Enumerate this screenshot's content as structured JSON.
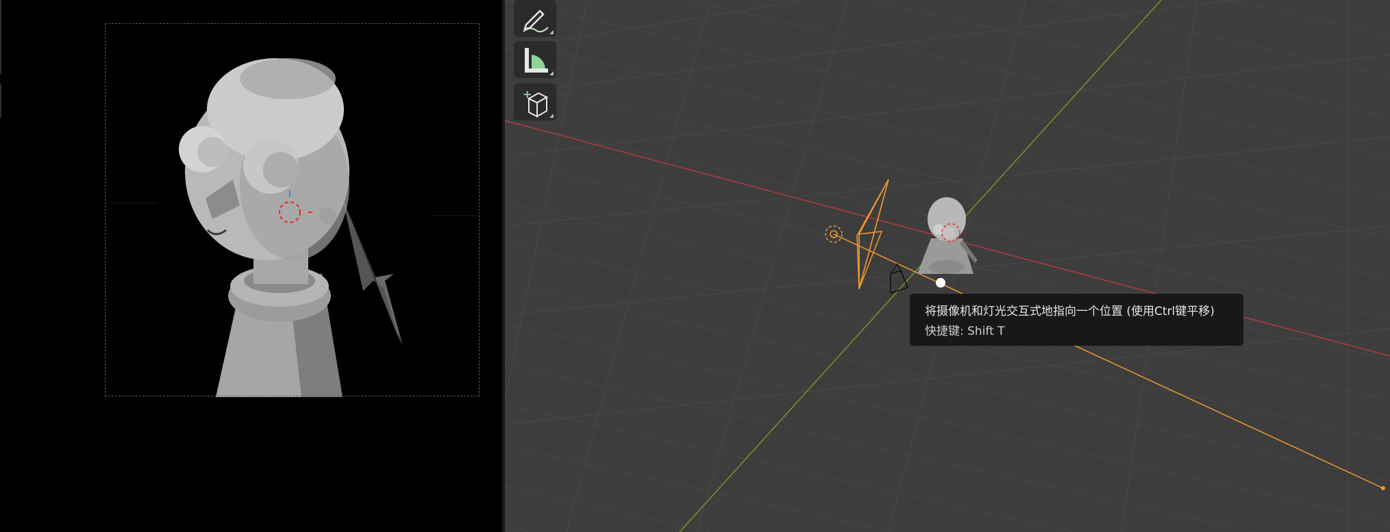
{
  "tooltip": {
    "description": "将摄像机和灯光交互式地指向一个位置 (使用Ctrl键平移)",
    "shortcut": "快捷键: Shift T"
  },
  "toolbar": {
    "tools": [
      {
        "name": "annotate",
        "icon": "pencil-annotate-icon"
      },
      {
        "name": "measure",
        "icon": "ruler-measure-icon"
      },
      {
        "name": "add-cube",
        "icon": "add-cube-icon"
      }
    ]
  },
  "colors": {
    "viewport_bg": "#3d3d3d",
    "grid": "#4a4a4a",
    "x_axis": "#b33a42",
    "y_axis": "#6e9a2c",
    "selection": "#f29a2f",
    "tool_icon": "#cfe8cc"
  }
}
